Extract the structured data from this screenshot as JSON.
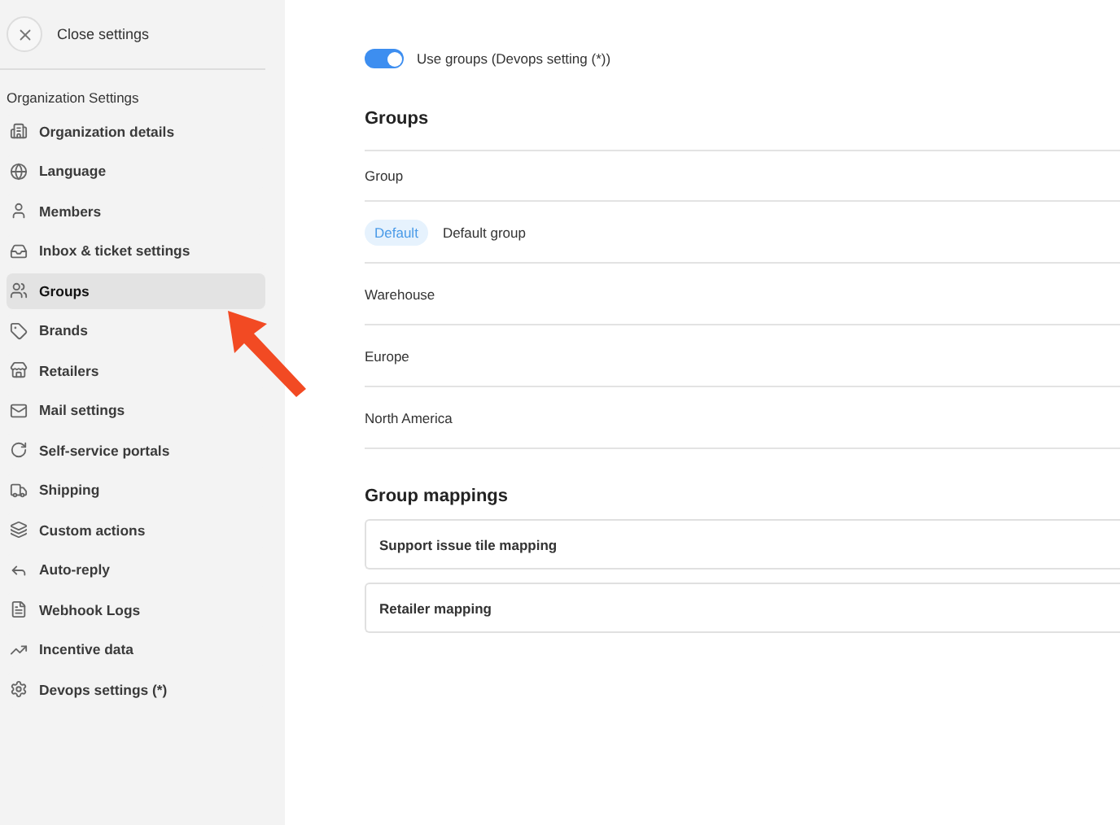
{
  "sidebar": {
    "close_label": "Close settings",
    "section_title": "Organization Settings",
    "items": [
      {
        "label": "Organization details",
        "selected": false
      },
      {
        "label": "Language",
        "selected": false
      },
      {
        "label": "Members",
        "selected": false
      },
      {
        "label": "Inbox & ticket settings",
        "selected": false
      },
      {
        "label": "Groups",
        "selected": true
      },
      {
        "label": "Brands",
        "selected": false
      },
      {
        "label": "Retailers",
        "selected": false
      },
      {
        "label": "Mail settings",
        "selected": false
      },
      {
        "label": "Self-service portals",
        "selected": false
      },
      {
        "label": "Shipping",
        "selected": false
      },
      {
        "label": "Custom actions",
        "selected": false
      },
      {
        "label": "Auto-reply",
        "selected": false
      },
      {
        "label": "Webhook Logs",
        "selected": false
      },
      {
        "label": "Incentive data",
        "selected": false
      },
      {
        "label": "Devops settings (*)",
        "selected": false
      }
    ]
  },
  "toggle": {
    "label": "Use groups (Devops setting (*))",
    "on": true
  },
  "groups": {
    "title": "Groups",
    "column_header": "Group",
    "rows": [
      {
        "name": "Default group",
        "badge": "Default"
      },
      {
        "name": "Warehouse"
      },
      {
        "name": "Europe"
      },
      {
        "name": "North America"
      }
    ]
  },
  "mappings": {
    "title": "Group mappings",
    "items": [
      "Support issue tile mapping",
      "Retailer mapping"
    ]
  }
}
